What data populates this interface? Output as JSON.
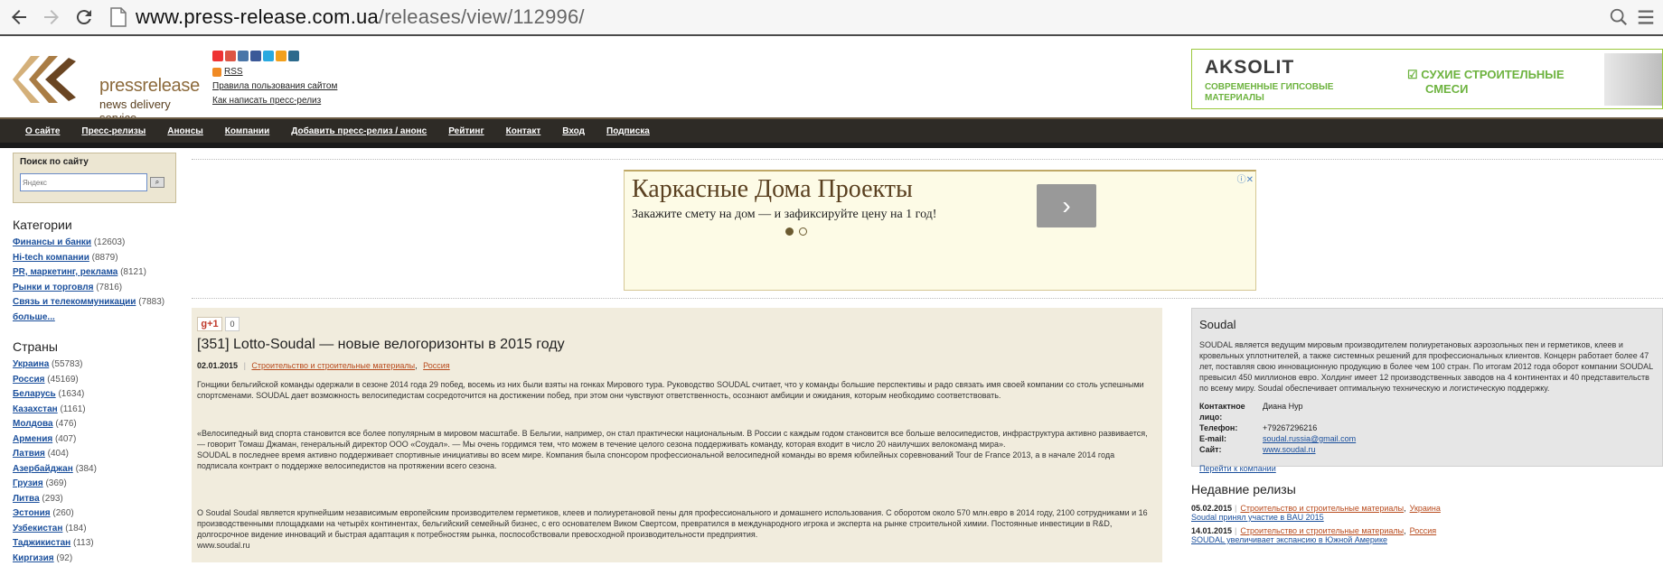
{
  "browser": {
    "url_host": "www.press-release.com.ua",
    "url_path": "/releases/view/112996/"
  },
  "logo": {
    "line1": "pressrelease",
    "line2": "news delivery service"
  },
  "header_links": {
    "rss": "RSS",
    "rules": "Правила пользования сайтом",
    "how_to": "Как написать пресс-релиз"
  },
  "banner": {
    "brand": "AKSOLIT",
    "subtitle_1": "СОВРЕМЕННЫЕ ГИПСОВЫЕ",
    "subtitle_2": "МАТЕРИАЛЫ",
    "check_1": "СУХИЕ СТРОИТЕЛЬНЫЕ",
    "check_2": "СМЕСИ",
    "accent": "#6db33f"
  },
  "menu": [
    "О сайте",
    "Пресс-релизы",
    "Анонсы",
    "Компании",
    "Добавить пресс-релиз / анонс",
    "Рейтинг",
    "Контакт",
    "Вход",
    "Подписка"
  ],
  "search": {
    "title": "Поиск по сайту",
    "placeholder": "Яндекс"
  },
  "categories": {
    "title": "Категории",
    "items": [
      {
        "label": "Финансы и банки",
        "count": "(12603)"
      },
      {
        "label": "Hi-tech компании",
        "count": "(8879)"
      },
      {
        "label": "PR, маркетинг, реклама",
        "count": "(8121)"
      },
      {
        "label": "Рынки и торговля",
        "count": "(7816)"
      },
      {
        "label": "Связь и телекоммуникации",
        "count": "(7883)"
      },
      {
        "label": "больше...",
        "count": ""
      }
    ]
  },
  "countries": {
    "title": "Страны",
    "items": [
      {
        "label": "Украина",
        "count": "(55783)"
      },
      {
        "label": "Россия",
        "count": "(45169)"
      },
      {
        "label": "Беларусь",
        "count": "(1634)"
      },
      {
        "label": "Казахстан",
        "count": "(1161)"
      },
      {
        "label": "Молдова",
        "count": "(476)"
      },
      {
        "label": "Армения",
        "count": "(407)"
      },
      {
        "label": "Латвия",
        "count": "(404)"
      },
      {
        "label": "Азербайджан",
        "count": "(384)"
      },
      {
        "label": "Грузия",
        "count": "(369)"
      },
      {
        "label": "Литва",
        "count": "(293)"
      },
      {
        "label": "Эстония",
        "count": "(260)"
      },
      {
        "label": "Узбекистан",
        "count": "(184)"
      },
      {
        "label": "Таджикистан",
        "count": "(113)"
      },
      {
        "label": "Киргизия",
        "count": "(92)"
      }
    ]
  },
  "ad": {
    "title": "Каркасные Дома Проекты",
    "text": "Закажите смету на дом — и зафиксируйте цену на 1 год!",
    "arrow": "›",
    "close": "ⓘ✕"
  },
  "article": {
    "gplus": "g+1",
    "gplus_count": "0",
    "title": "[351] Lotto-Soudal — новые велогоризонты в 2015 году",
    "date": "02.01.2015",
    "category": "Строительство и строительные материалы",
    "country": "Россия",
    "p1": "Гонщики бельгийской команды одержали в сезоне 2014 года 29 побед, восемь из них были взяты на гонках Мирового тура. Руководство SOUDAL считает, что у команды большие перспективы и радо связать имя своей компании со столь успешными спортсменами. SOUDAL дает возможность велосипедистам сосредоточится на достижении побед, при этом они чувствуют ответственность, осознают амбиции и ожидания, которым необходимо соответствовать.",
    "p2": "«Велосипедный вид спорта становится все более популярным в мировом масштабе. В Бельгии, например, он стал практически национальным. В России с каждым годом становится все больше велосипедистов, инфраструктура активно развивается, — говорит Томаш Джаман, генеральный директор ООО «Соудал». — Мы очень гордимся тем, что можем в течение целого сезона поддерживать команду, которая входит в число 20 наилучших велокоманд мира».",
    "p3": "SOUDAL в последнее время активно поддерживает спортивные инициативы во всем мире. Компания была спонсором профессиональной велосипедной команды во время юбилейных соревнований Tour de France 2013, а в начале 2014 года подписала контракт о поддержке велосипедистов на протяжении всего сезона.",
    "p4": "О Soudal Soudal является крупнейшим независимым европейским производителем герметиков, клеев и полиуретановой пены для профессионального и домашнего использования. С оборотом около 570 млн.евро в 2014 году, 2100 сотрудниками и 16 производственными площадками на четырёх континентах, бельгийский семейный бизнес, с его основателем Виком Свертсом, превратился в международного игрока и эксперта на рынке строительной химии. Постоянные инвестиции в R&D, долгосрочное видение инноваций и быстрая адаптация к потребностям рынка, поспособствовали превосходной производительности предприятия.",
    "p5": "www.soudal.ru"
  },
  "company": {
    "name": "Soudal",
    "desc": "SOUDAL является ведущим мировым производителем полиуретановых аэрозольных пен и герметиков, клеев и кровельных уплотнителей, а также системных решений для профессиональных клиентов. Концерн работает более 47 лет, поставляя свою инновационную продукцию в более чем 100 стран. По итогам 2012 года оборот компании SOUDAL превысил 450 миллионов евро. Холдинг имеет 12 производственных заводов на 4 континентах и 40 представительств по всему миру. Soudal обеспечивает оптимальную техническую и логистическую поддержку.",
    "contact_label": "Контактное лицо:",
    "contact_value": "Диана Нур",
    "phone_label": "Телефон:",
    "phone_value": "+79267296216",
    "email_label": "E-mail:",
    "email_value": "soudal.russia@gmail.com",
    "site_label": "Сайт:",
    "site_value": "www.soudal.ru",
    "link": "Перейти к компании"
  },
  "recent": {
    "title": "Недавние релизы",
    "items": [
      {
        "date": "05.02.2015",
        "category": "Строительство и строительные материалы",
        "country": "Украина",
        "title": "Soudal принял участие в BAU 2015"
      },
      {
        "date": "14.01.2015",
        "category": "Строительство и строительные материалы",
        "country": "Россия",
        "title": "SOUDAL увеличивает экспансию в Южной Америке"
      }
    ]
  }
}
